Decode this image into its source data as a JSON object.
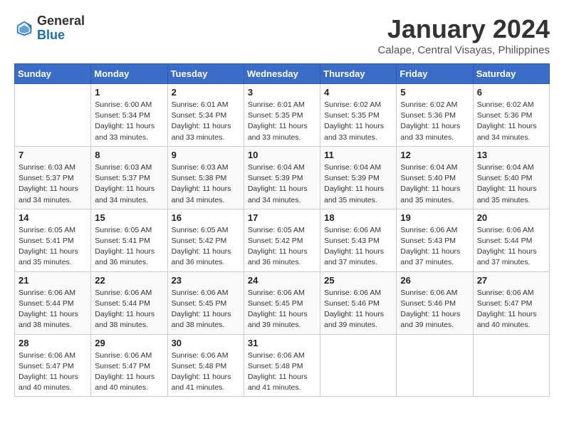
{
  "header": {
    "logo": {
      "general": "General",
      "blue": "Blue"
    },
    "title": "January 2024",
    "location": "Calape, Central Visayas, Philippines"
  },
  "days_of_week": [
    "Sunday",
    "Monday",
    "Tuesday",
    "Wednesday",
    "Thursday",
    "Friday",
    "Saturday"
  ],
  "weeks": [
    [
      {
        "day": "",
        "info": []
      },
      {
        "day": "1",
        "info": [
          "Sunrise: 6:00 AM",
          "Sunset: 5:34 PM",
          "Daylight: 11 hours",
          "and 33 minutes."
        ]
      },
      {
        "day": "2",
        "info": [
          "Sunrise: 6:01 AM",
          "Sunset: 5:34 PM",
          "Daylight: 11 hours",
          "and 33 minutes."
        ]
      },
      {
        "day": "3",
        "info": [
          "Sunrise: 6:01 AM",
          "Sunset: 5:35 PM",
          "Daylight: 11 hours",
          "and 33 minutes."
        ]
      },
      {
        "day": "4",
        "info": [
          "Sunrise: 6:02 AM",
          "Sunset: 5:35 PM",
          "Daylight: 11 hours",
          "and 33 minutes."
        ]
      },
      {
        "day": "5",
        "info": [
          "Sunrise: 6:02 AM",
          "Sunset: 5:36 PM",
          "Daylight: 11 hours",
          "and 33 minutes."
        ]
      },
      {
        "day": "6",
        "info": [
          "Sunrise: 6:02 AM",
          "Sunset: 5:36 PM",
          "Daylight: 11 hours",
          "and 34 minutes."
        ]
      }
    ],
    [
      {
        "day": "7",
        "info": [
          "Sunrise: 6:03 AM",
          "Sunset: 5:37 PM",
          "Daylight: 11 hours",
          "and 34 minutes."
        ]
      },
      {
        "day": "8",
        "info": [
          "Sunrise: 6:03 AM",
          "Sunset: 5:37 PM",
          "Daylight: 11 hours",
          "and 34 minutes."
        ]
      },
      {
        "day": "9",
        "info": [
          "Sunrise: 6:03 AM",
          "Sunset: 5:38 PM",
          "Daylight: 11 hours",
          "and 34 minutes."
        ]
      },
      {
        "day": "10",
        "info": [
          "Sunrise: 6:04 AM",
          "Sunset: 5:39 PM",
          "Daylight: 11 hours",
          "and 34 minutes."
        ]
      },
      {
        "day": "11",
        "info": [
          "Sunrise: 6:04 AM",
          "Sunset: 5:39 PM",
          "Daylight: 11 hours",
          "and 35 minutes."
        ]
      },
      {
        "day": "12",
        "info": [
          "Sunrise: 6:04 AM",
          "Sunset: 5:40 PM",
          "Daylight: 11 hours",
          "and 35 minutes."
        ]
      },
      {
        "day": "13",
        "info": [
          "Sunrise: 6:04 AM",
          "Sunset: 5:40 PM",
          "Daylight: 11 hours",
          "and 35 minutes."
        ]
      }
    ],
    [
      {
        "day": "14",
        "info": [
          "Sunrise: 6:05 AM",
          "Sunset: 5:41 PM",
          "Daylight: 11 hours",
          "and 35 minutes."
        ]
      },
      {
        "day": "15",
        "info": [
          "Sunrise: 6:05 AM",
          "Sunset: 5:41 PM",
          "Daylight: 11 hours",
          "and 36 minutes."
        ]
      },
      {
        "day": "16",
        "info": [
          "Sunrise: 6:05 AM",
          "Sunset: 5:42 PM",
          "Daylight: 11 hours",
          "and 36 minutes."
        ]
      },
      {
        "day": "17",
        "info": [
          "Sunrise: 6:05 AM",
          "Sunset: 5:42 PM",
          "Daylight: 11 hours",
          "and 36 minutes."
        ]
      },
      {
        "day": "18",
        "info": [
          "Sunrise: 6:06 AM",
          "Sunset: 5:43 PM",
          "Daylight: 11 hours",
          "and 37 minutes."
        ]
      },
      {
        "day": "19",
        "info": [
          "Sunrise: 6:06 AM",
          "Sunset: 5:43 PM",
          "Daylight: 11 hours",
          "and 37 minutes."
        ]
      },
      {
        "day": "20",
        "info": [
          "Sunrise: 6:06 AM",
          "Sunset: 5:44 PM",
          "Daylight: 11 hours",
          "and 37 minutes."
        ]
      }
    ],
    [
      {
        "day": "21",
        "info": [
          "Sunrise: 6:06 AM",
          "Sunset: 5:44 PM",
          "Daylight: 11 hours",
          "and 38 minutes."
        ]
      },
      {
        "day": "22",
        "info": [
          "Sunrise: 6:06 AM",
          "Sunset: 5:44 PM",
          "Daylight: 11 hours",
          "and 38 minutes."
        ]
      },
      {
        "day": "23",
        "info": [
          "Sunrise: 6:06 AM",
          "Sunset: 5:45 PM",
          "Daylight: 11 hours",
          "and 38 minutes."
        ]
      },
      {
        "day": "24",
        "info": [
          "Sunrise: 6:06 AM",
          "Sunset: 5:45 PM",
          "Daylight: 11 hours",
          "and 39 minutes."
        ]
      },
      {
        "day": "25",
        "info": [
          "Sunrise: 6:06 AM",
          "Sunset: 5:46 PM",
          "Daylight: 11 hours",
          "and 39 minutes."
        ]
      },
      {
        "day": "26",
        "info": [
          "Sunrise: 6:06 AM",
          "Sunset: 5:46 PM",
          "Daylight: 11 hours",
          "and 39 minutes."
        ]
      },
      {
        "day": "27",
        "info": [
          "Sunrise: 6:06 AM",
          "Sunset: 5:47 PM",
          "Daylight: 11 hours",
          "and 40 minutes."
        ]
      }
    ],
    [
      {
        "day": "28",
        "info": [
          "Sunrise: 6:06 AM",
          "Sunset: 5:47 PM",
          "Daylight: 11 hours",
          "and 40 minutes."
        ]
      },
      {
        "day": "29",
        "info": [
          "Sunrise: 6:06 AM",
          "Sunset: 5:47 PM",
          "Daylight: 11 hours",
          "and 40 minutes."
        ]
      },
      {
        "day": "30",
        "info": [
          "Sunrise: 6:06 AM",
          "Sunset: 5:48 PM",
          "Daylight: 11 hours",
          "and 41 minutes."
        ]
      },
      {
        "day": "31",
        "info": [
          "Sunrise: 6:06 AM",
          "Sunset: 5:48 PM",
          "Daylight: 11 hours",
          "and 41 minutes."
        ]
      },
      {
        "day": "",
        "info": []
      },
      {
        "day": "",
        "info": []
      },
      {
        "day": "",
        "info": []
      }
    ]
  ]
}
